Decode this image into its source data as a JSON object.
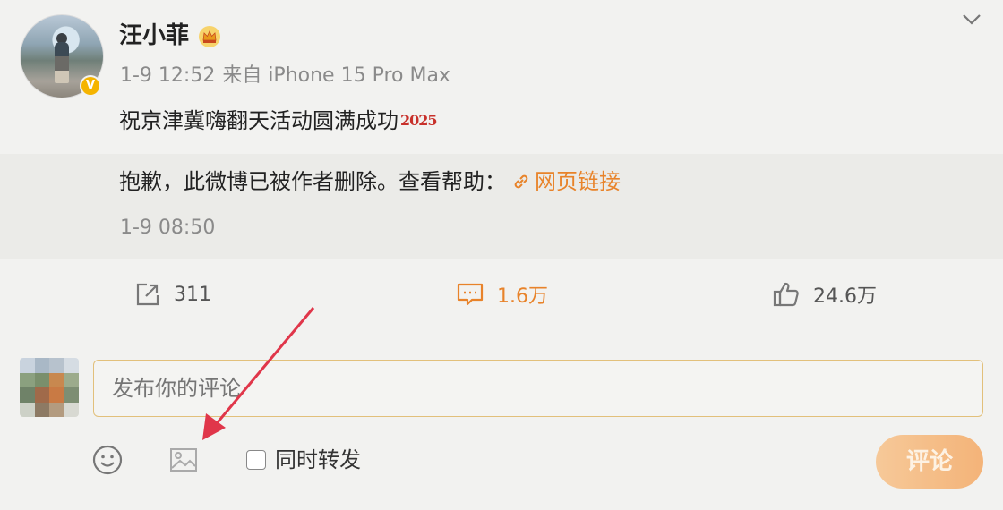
{
  "post": {
    "username": "汪小菲",
    "time": "1-9 12:52",
    "source": "来自 iPhone 15 Pro Max",
    "text": "祝京津冀嗨翻天活动圆满成功",
    "text_emoji": "2025"
  },
  "repost": {
    "deleted_notice": "抱歉，此微博已被作者删除。查看帮助：",
    "link_label": "网页链接",
    "time": "1-9 08:50"
  },
  "actions": {
    "repost_count": "311",
    "comment_count": "1.6万",
    "like_count": "24.6万"
  },
  "composer": {
    "placeholder": "发布你的评论",
    "also_repost_label": "同时转发",
    "submit_label": "评论"
  },
  "colors": {
    "accent": "#e8832a",
    "verified_badge": "#f5b400",
    "annotation_arrow": "#e0364a",
    "input_border": "#e2c07b"
  },
  "icons": {
    "menu": "chevron-down-icon",
    "repost": "share-icon",
    "comment": "comment-icon",
    "like": "thumbs-up-icon",
    "emoji": "smiley-icon",
    "image": "image-icon",
    "verified": "verified-v-icon",
    "crown": "crown-icon"
  }
}
